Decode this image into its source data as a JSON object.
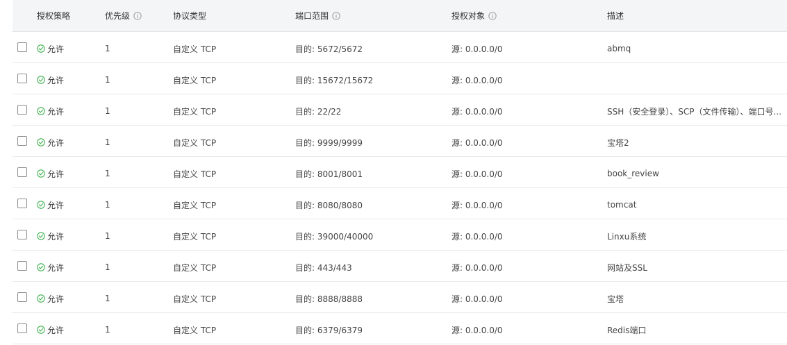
{
  "table": {
    "headers": {
      "policy": "授权策略",
      "priority": "优先级",
      "protocol": "协议类型",
      "port": "端口范围",
      "target": "授权对象",
      "description": "描述"
    },
    "rows": [
      {
        "policy": "允许",
        "priority": "1",
        "protocol": "自定义 TCP",
        "port": "目的: 5672/5672",
        "target": "源: 0.0.0.0/0",
        "description": "abmq"
      },
      {
        "policy": "允许",
        "priority": "1",
        "protocol": "自定义 TCP",
        "port": "目的: 15672/15672",
        "target": "源: 0.0.0.0/0",
        "description": ""
      },
      {
        "policy": "允许",
        "priority": "1",
        "protocol": "自定义 TCP",
        "port": "目的: 22/22",
        "target": "源: 0.0.0.0/0",
        "description": "SSH（安全登录）、SCP（文件传输）、端口号..."
      },
      {
        "policy": "允许",
        "priority": "1",
        "protocol": "自定义 TCP",
        "port": "目的: 9999/9999",
        "target": "源: 0.0.0.0/0",
        "description": "宝塔2"
      },
      {
        "policy": "允许",
        "priority": "1",
        "protocol": "自定义 TCP",
        "port": "目的: 8001/8001",
        "target": "源: 0.0.0.0/0",
        "description": "book_review"
      },
      {
        "policy": "允许",
        "priority": "1",
        "protocol": "自定义 TCP",
        "port": "目的: 8080/8080",
        "target": "源: 0.0.0.0/0",
        "description": "tomcat"
      },
      {
        "policy": "允许",
        "priority": "1",
        "protocol": "自定义 TCP",
        "port": "目的: 39000/40000",
        "target": "源: 0.0.0.0/0",
        "description": "Linxu系统"
      },
      {
        "policy": "允许",
        "priority": "1",
        "protocol": "自定义 TCP",
        "port": "目的: 443/443",
        "target": "源: 0.0.0.0/0",
        "description": "网站及SSL"
      },
      {
        "policy": "允许",
        "priority": "1",
        "protocol": "自定义 TCP",
        "port": "目的: 8888/8888",
        "target": "源: 0.0.0.0/0",
        "description": "宝塔"
      },
      {
        "policy": "允许",
        "priority": "1",
        "protocol": "自定义 TCP",
        "port": "目的: 6379/6379",
        "target": "源: 0.0.0.0/0",
        "description": "Redis端口"
      }
    ]
  },
  "colors": {
    "header_bg": "#f4f5f7",
    "allow_green": "#3fb34f",
    "border": "#e8e9eb"
  },
  "icons": {
    "info": "info-circle-icon",
    "allow": "check-circle-icon"
  }
}
